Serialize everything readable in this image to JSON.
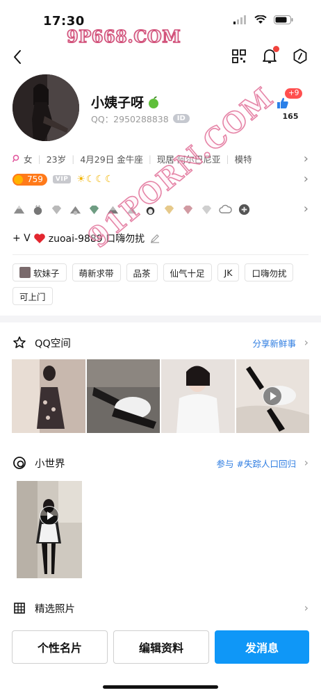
{
  "status": {
    "time": "17:30"
  },
  "watermark": {
    "site": "9P668.COM",
    "diagonal": "91PORN.COM"
  },
  "profile": {
    "name": "小姨子呀",
    "qq_line": "QQ：2950288838",
    "id_badge": "ID",
    "like_badge": "+9",
    "like_count": "165"
  },
  "info": {
    "gender": "女",
    "age": "23岁",
    "birthday": "4月29日 金牛座",
    "location": "现居 阿尔巴尼亚",
    "job": "模特"
  },
  "level": {
    "value": "759",
    "vip": "VIP"
  },
  "signature": "+ V",
  "signature_rest": "zuoai-9889 口嗨勿扰",
  "tags": [
    "软妹子",
    "萌新求带",
    "品茶",
    "仙气十足",
    "JK",
    "口嗨勿扰",
    "可上门"
  ],
  "qzone": {
    "title": "QQ空间",
    "action": "分享新鲜事"
  },
  "world": {
    "title": "小世界",
    "action": "参与 #失踪人口回归"
  },
  "photos_section": {
    "title": "精选照片"
  },
  "buttons": {
    "card": "个性名片",
    "edit": "编辑资料",
    "message": "发消息"
  },
  "colors": {
    "accent": "#0f97f7",
    "link": "#2f7de1",
    "badge_red": "#ff4f4f",
    "level_orange": "#ff7a1a"
  }
}
